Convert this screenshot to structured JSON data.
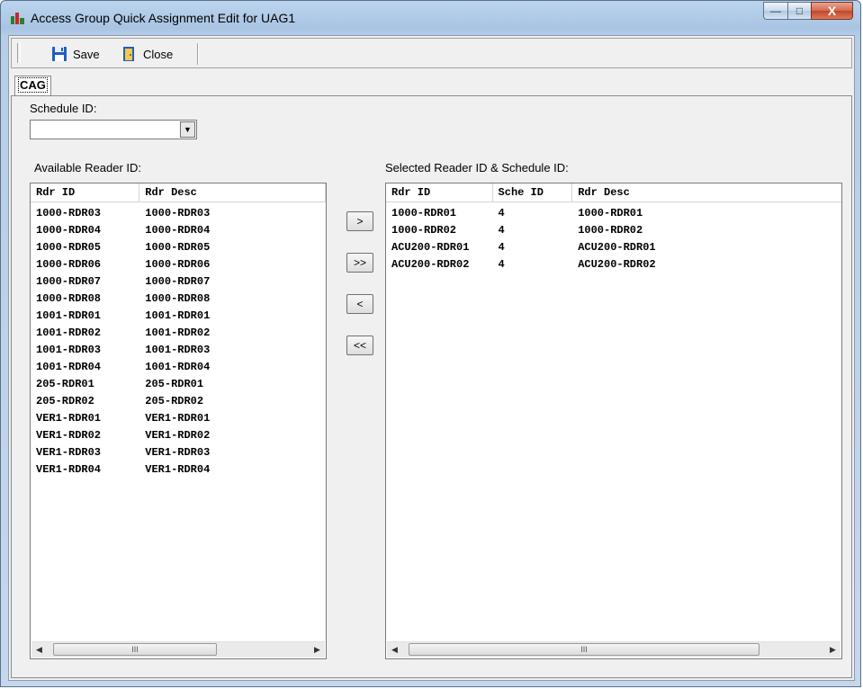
{
  "window": {
    "title": "Access Group Quick Assignment Edit for UAG1",
    "min_glyph": "—",
    "max_glyph": "□",
    "close_glyph": "X"
  },
  "toolbar": {
    "save_label": "Save",
    "close_label": "Close"
  },
  "tabs": [
    "CAG"
  ],
  "form": {
    "schedule_label": "Schedule ID:",
    "schedule_value": "",
    "combo_arrow": "▼"
  },
  "available": {
    "label": "Available Reader ID:",
    "columns": [
      "Rdr ID",
      "Rdr Desc"
    ],
    "rows": [
      [
        "1000-RDR03",
        "1000-RDR03"
      ],
      [
        "1000-RDR04",
        "1000-RDR04"
      ],
      [
        "1000-RDR05",
        "1000-RDR05"
      ],
      [
        "1000-RDR06",
        "1000-RDR06"
      ],
      [
        "1000-RDR07",
        "1000-RDR07"
      ],
      [
        "1000-RDR08",
        "1000-RDR08"
      ],
      [
        "1001-RDR01",
        "1001-RDR01"
      ],
      [
        "1001-RDR02",
        "1001-RDR02"
      ],
      [
        "1001-RDR03",
        "1001-RDR03"
      ],
      [
        "1001-RDR04",
        "1001-RDR04"
      ],
      [
        "205-RDR01",
        "205-RDR01"
      ],
      [
        "205-RDR02",
        "205-RDR02"
      ],
      [
        "VER1-RDR01",
        "VER1-RDR01"
      ],
      [
        "VER1-RDR02",
        "VER1-RDR02"
      ],
      [
        "VER1-RDR03",
        "VER1-RDR03"
      ],
      [
        "VER1-RDR04",
        "VER1-RDR04"
      ]
    ]
  },
  "selected": {
    "label": "Selected Reader ID & Schedule ID:",
    "columns": [
      "Rdr ID",
      "Sche ID",
      "Rdr Desc"
    ],
    "rows": [
      [
        "1000-RDR01",
        "4",
        "1000-RDR01"
      ],
      [
        "1000-RDR02",
        "4",
        "1000-RDR02"
      ],
      [
        "ACU200-RDR01",
        "4",
        "ACU200-RDR01"
      ],
      [
        "ACU200-RDR02",
        "4",
        "ACU200-RDR02"
      ]
    ]
  },
  "move_buttons": {
    "add_one": ">",
    "add_all": ">>",
    "remove_one": "<",
    "remove_all": "<<"
  },
  "scroll": {
    "left_arrow": "◀",
    "right_arrow": "▶",
    "thumb_grip": "III"
  },
  "colors": {
    "window_frame": "#a9c4e3",
    "client_bg": "#f0f0f0",
    "close_button": "#c4442a"
  }
}
